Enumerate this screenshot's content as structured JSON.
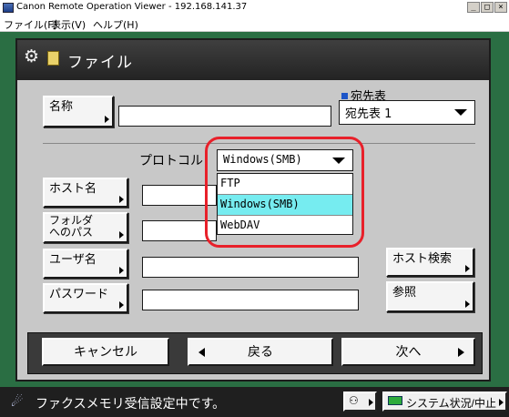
{
  "window": {
    "title": "Canon Remote Operation Viewer - 192.168.141.37",
    "buttons": {
      "minimize": "_",
      "maximize": "□",
      "close": "×"
    }
  },
  "menubar": {
    "items": [
      "ファイル(F)",
      "表示(V)",
      "ヘルプ(H)"
    ]
  },
  "panel": {
    "title": "ファイル",
    "name_button": "名称",
    "name_value": "",
    "address_book_label": "宛先表",
    "address_book_value": "宛先表 1",
    "protocol_label": "プロトコル",
    "protocol_value": "Windows(SMB)",
    "protocol_options": [
      "FTP",
      "Windows(SMB)",
      "WebDAV"
    ],
    "protocol_selected_index": 1,
    "host_button": "ホスト名",
    "folder_button_line1": "フォルダ",
    "folder_button_line2": "へのパス",
    "user_button": "ユーザ名",
    "password_button": "パスワード",
    "host_search_button": "ホスト検索",
    "browse_button": "参照",
    "cancel_button": "キャンセル",
    "back_button": "戻る",
    "next_button": "次へ"
  },
  "statusbar": {
    "message": "ファクスメモリ受信設定中です。",
    "system_button": "システム状況/中止"
  },
  "colors": {
    "frame_green": "#2a6e43",
    "panel_gray": "#c8c8c8",
    "selected_option": "#76ecf0",
    "highlight_red": "#e8202a",
    "address_square": "#1d55c8"
  }
}
